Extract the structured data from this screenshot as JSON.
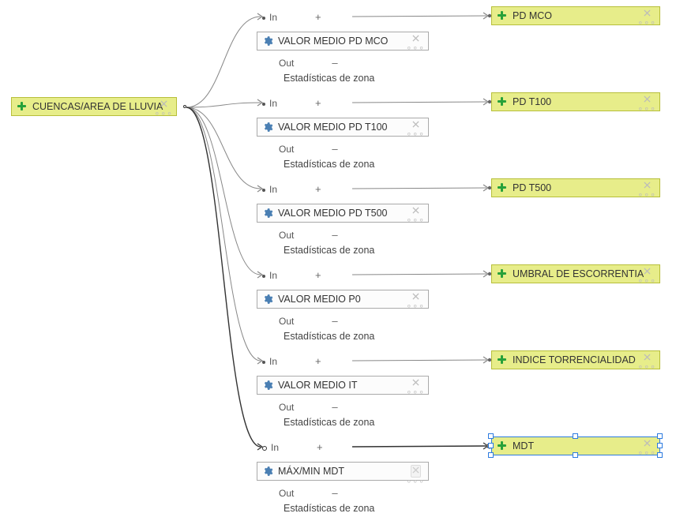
{
  "source_node": {
    "label": "CUENCAS/AREA DE LLUVIA"
  },
  "branches": [
    {
      "input_label": "PD MCO",
      "algo_label": "VALOR MEDIO PD MCO",
      "out_label": "Out",
      "desc": "Estadísticas de zona"
    },
    {
      "input_label": "PD T100",
      "algo_label": "VALOR MEDIO PD T100",
      "out_label": "Out",
      "desc": "Estadísticas de zona"
    },
    {
      "input_label": "PD T500",
      "algo_label": "VALOR MEDIO PD T500",
      "out_label": "Out",
      "desc": "Estadísticas de zona"
    },
    {
      "input_label": "UMBRAL DE ESCORRENTIA",
      "algo_label": "VALOR MEDIO P0",
      "out_label": "Out",
      "desc": "Estadísticas de zona"
    },
    {
      "input_label": "INDICE TORRENCIALIDAD",
      "algo_label": "VALOR MEDIO IT",
      "out_label": "Out",
      "desc": "Estadísticas de zona"
    },
    {
      "input_label": "MDT",
      "algo_label": "MÁX/MIN MDT",
      "out_label": "Out",
      "desc": "Estadísticas de zona",
      "selected": true
    }
  ],
  "port_labels": {
    "in": "In",
    "plus": "+"
  }
}
